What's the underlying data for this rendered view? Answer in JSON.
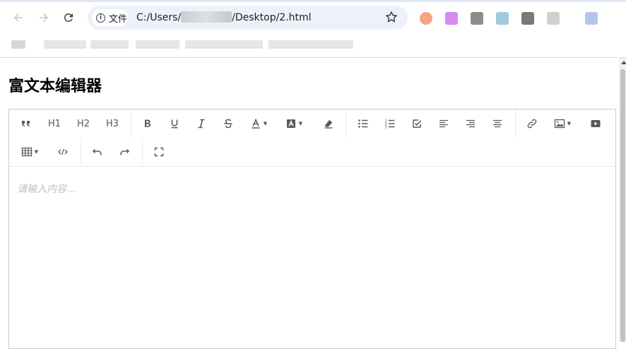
{
  "browser": {
    "site_chip_label": "文件",
    "url_prefix": "C:/Users/",
    "url_suffix": "/Desktop/2.html",
    "extension_colors": [
      "#f4a583",
      "#d58cf0",
      "#8c8c8c",
      "#9fcbdc",
      "#7a7a7a",
      "#d0d0d0",
      "#b7c4f2"
    ]
  },
  "page": {
    "title": "富文本编辑器"
  },
  "toolbar": {
    "h1_label": "H1",
    "h2_label": "H2",
    "h3_label": "H3"
  },
  "editor": {
    "placeholder": "请输入内容..."
  }
}
